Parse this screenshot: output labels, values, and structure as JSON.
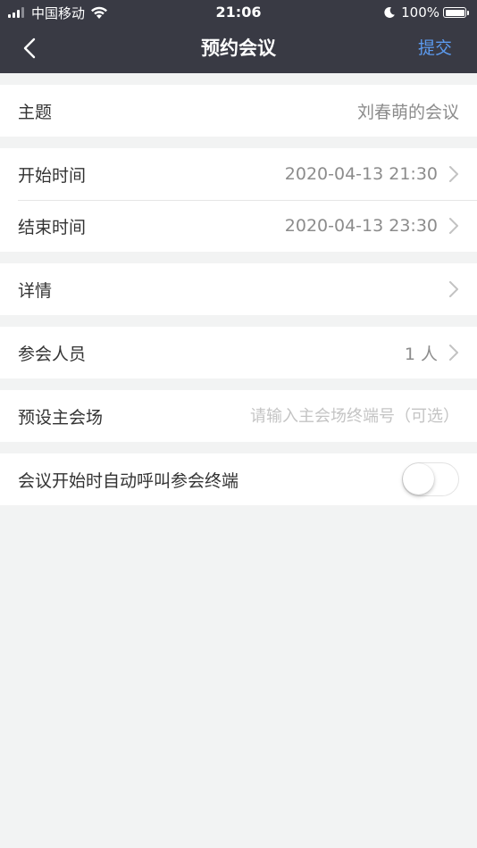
{
  "status_bar": {
    "carrier": "中国移动",
    "time": "21:06",
    "battery": "100%"
  },
  "nav": {
    "title": "预约会议",
    "submit_label": "提交"
  },
  "form": {
    "topic": {
      "label": "主题",
      "value": "刘春萌的会议"
    },
    "start_time": {
      "label": "开始时间",
      "value": "2020-04-13 21:30"
    },
    "end_time": {
      "label": "结束时间",
      "value": "2020-04-13 23:30"
    },
    "details": {
      "label": "详情"
    },
    "participants": {
      "label": "参会人员",
      "value": "1 人"
    },
    "main_venue": {
      "label": "预设主会场",
      "placeholder": "请输入主会场终端号（可选）"
    },
    "auto_call": {
      "label": "会议开始时自动呼叫参会终端",
      "enabled": false
    }
  },
  "colors": {
    "header_bg": "#393a44",
    "accent": "#5c9bf0",
    "page_bg": "#f2f3f3"
  },
  "icons": [
    "signal-icon",
    "wifi-icon",
    "moon-icon",
    "battery-icon",
    "back-arrow-icon",
    "chevron-right-icon"
  ]
}
